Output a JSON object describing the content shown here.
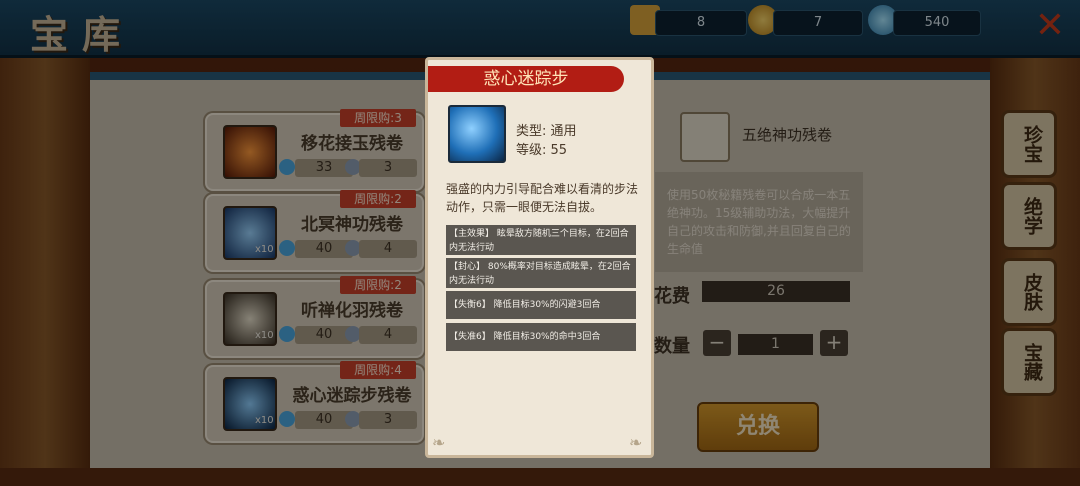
{
  "header": {
    "title": "宝库",
    "resources": [
      {
        "icon": "scroll-icon",
        "value": "8"
      },
      {
        "icon": "gold-coin-icon",
        "value": "7"
      },
      {
        "icon": "crystal-icon",
        "value": "540"
      }
    ]
  },
  "items": [
    {
      "name": "移花接玉残卷",
      "tag": "周限购:3",
      "cost": "33",
      "stock": "3",
      "multiplier": ""
    },
    {
      "name": "北冥神功残卷",
      "tag": "周限购:2",
      "cost": "40",
      "stock": "4",
      "multiplier": "x10"
    },
    {
      "name": "听禅化羽残卷",
      "tag": "周限购:2",
      "cost": "40",
      "stock": "4",
      "multiplier": "x10"
    },
    {
      "name": "惑心迷踪步残卷",
      "tag": "周限购:4",
      "cost": "40",
      "stock": "3",
      "multiplier": "x10"
    }
  ],
  "detail": {
    "name": "五绝神功残卷",
    "description": "使用50枚秘籍残卷可以合成一本五绝神功。15级辅助功法，大幅提升自己的攻击和防御,并且回复自己的生命值",
    "cost_label": "花费",
    "cost_value": "26",
    "quantity_label": "数量",
    "quantity_value": "1",
    "minus": "−",
    "plus": "+",
    "exchange_label": "兑换"
  },
  "side_tabs": [
    "珍宝",
    "绝学",
    "皮肤",
    "宝藏"
  ],
  "popup": {
    "title": "惑心迷踪步",
    "type": "类型: 通用",
    "level": "等级: 55",
    "description": "强盛的内力引导配合难以看清的步法动作，只需一眼便无法自拔。",
    "effects": [
      "【主效果】 眩晕敌方随机三个目标，在2回合内无法行动",
      "【封心】 80%概率对目标造成眩晕，在2回合内无法行动",
      "【失衡6】 降低目标30%的闪避3回合",
      "【失准6】 降低目标30%的命中3回合"
    ]
  },
  "colors": {
    "title_red": "#b21d14",
    "tag_red": "#c8402a",
    "header_blue": "#1c4a66"
  }
}
